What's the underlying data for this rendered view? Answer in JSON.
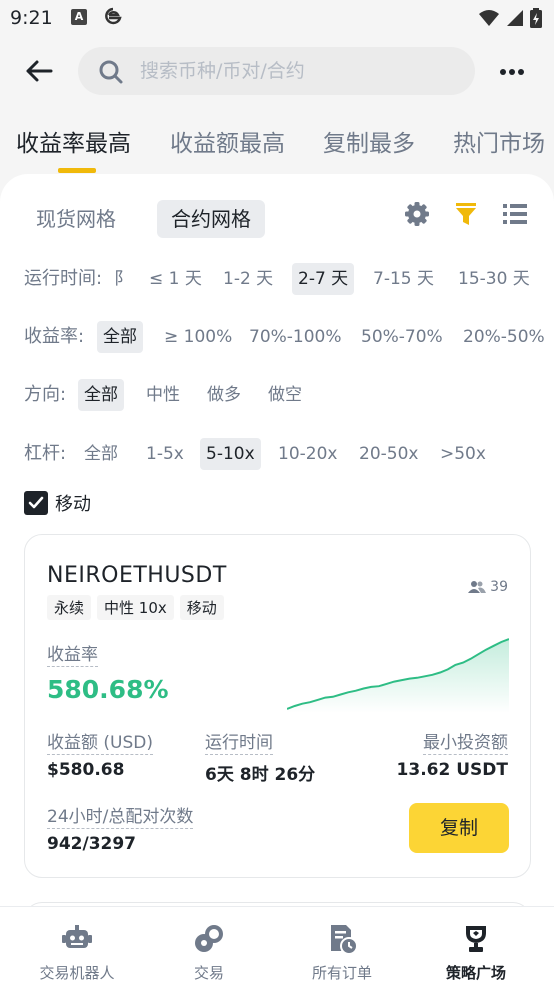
{
  "status": {
    "time": "9:21",
    "app_badge": "A"
  },
  "header": {
    "search_placeholder": "搜索币种/币对/合约"
  },
  "main_tabs": [
    {
      "label": "收益率最高"
    },
    {
      "label": "收益额最高"
    },
    {
      "label": "复制最多"
    },
    {
      "label": "热门市场"
    }
  ],
  "grid_tabs": [
    {
      "label": "现货网格"
    },
    {
      "label": "合约网格"
    }
  ],
  "filters": {
    "runtime": {
      "label": "运行时间:",
      "cut_text": "阝",
      "options": [
        "≤ 1 天",
        "1-2 天",
        "2-7 天",
        "7-15 天",
        "15-30 天"
      ],
      "selected": "2-7 天"
    },
    "roi": {
      "label": "收益率:",
      "options": [
        "全部",
        "≥ 100%",
        "70%-100%",
        "50%-70%",
        "20%-50%"
      ],
      "selected": "全部"
    },
    "direction": {
      "label": "方向:",
      "options": [
        "全部",
        "中性",
        "做多",
        "做空"
      ],
      "selected": "全部"
    },
    "leverage": {
      "label": "杠杆:",
      "options": [
        "全部",
        "1-5x",
        "5-10x",
        "10-20x",
        "20-50x",
        ">50x"
      ],
      "selected": "5-10x"
    }
  },
  "trailing_checkbox": {
    "label": "移动",
    "checked": true
  },
  "card": {
    "symbol": "NEIROETHUSDT",
    "followers": "39",
    "tags": [
      "永续",
      "中性 10x",
      "移动"
    ],
    "roi_label": "收益率",
    "roi_value": "580.68%",
    "pnl_label": "收益额 (USD)",
    "pnl_value": "$580.68",
    "runtime_label": "运行时间",
    "runtime_value": "6天 8时 26分",
    "min_invest_label": "最小投资额",
    "min_invest_value": "13.62 USDT",
    "matches_label": "24小时/总配对次数",
    "matches_value": "942/3297",
    "copy_label": "复制",
    "sparkline": [
      0,
      4,
      7,
      9,
      12,
      15,
      16,
      19,
      22,
      24,
      27,
      29,
      30,
      33,
      36,
      38,
      40,
      41,
      43,
      45,
      48,
      52,
      58,
      61,
      66,
      72,
      78,
      83,
      88,
      92
    ]
  },
  "bottom_nav": [
    {
      "label": "交易机器人",
      "icon": "robot-icon"
    },
    {
      "label": "交易",
      "icon": "trade-icon"
    },
    {
      "label": "所有订单",
      "icon": "orders-icon"
    },
    {
      "label": "策略广场",
      "icon": "trophy-icon"
    }
  ],
  "colors": {
    "accent": "#F0B90B",
    "button": "#FCD535",
    "positive": "#2EBD85"
  }
}
